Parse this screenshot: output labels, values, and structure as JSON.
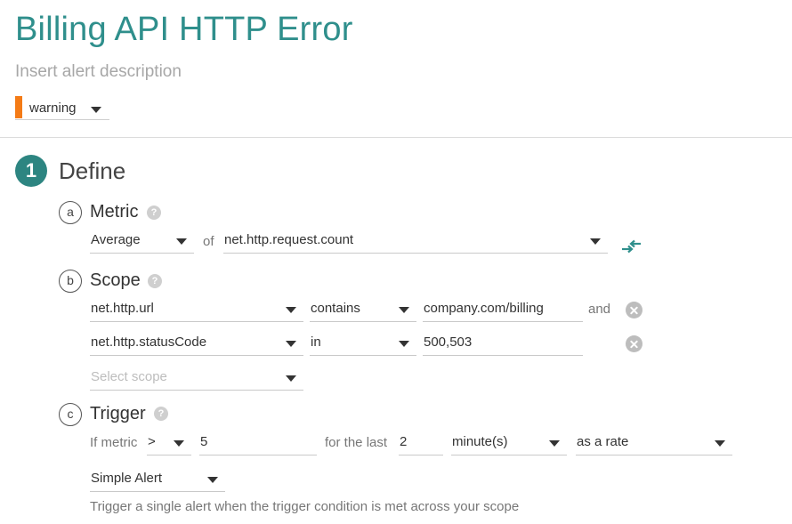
{
  "alert": {
    "title": "Billing API HTTP Error",
    "description_placeholder": "Insert alert description",
    "severity": "warning",
    "severity_color": "#f47b16"
  },
  "step": {
    "number": "1",
    "title": "Define"
  },
  "metric": {
    "letter": "a",
    "title": "Metric",
    "aggregation": "Average",
    "of_label": "of",
    "name": "net.http.request.count"
  },
  "scope": {
    "letter": "b",
    "title": "Scope",
    "rows": [
      {
        "key": "net.http.url",
        "operator": "contains",
        "value": "company.com/billing",
        "joiner": "and"
      },
      {
        "key": "net.http.statusCode",
        "operator": "in",
        "value": "500,503",
        "joiner": ""
      }
    ],
    "select_placeholder": "Select scope"
  },
  "trigger": {
    "letter": "c",
    "title": "Trigger",
    "if_label": "If metric",
    "comparator": ">",
    "threshold": "5",
    "for_label": "for the last",
    "duration": "2",
    "unit": "minute(s)",
    "mode": "as a rate",
    "alert_type": "Simple Alert",
    "description": "Trigger a single alert when the trigger condition is met across your scope"
  },
  "colors": {
    "accent": "#2f8f8c",
    "step_badge": "#2d8581"
  }
}
